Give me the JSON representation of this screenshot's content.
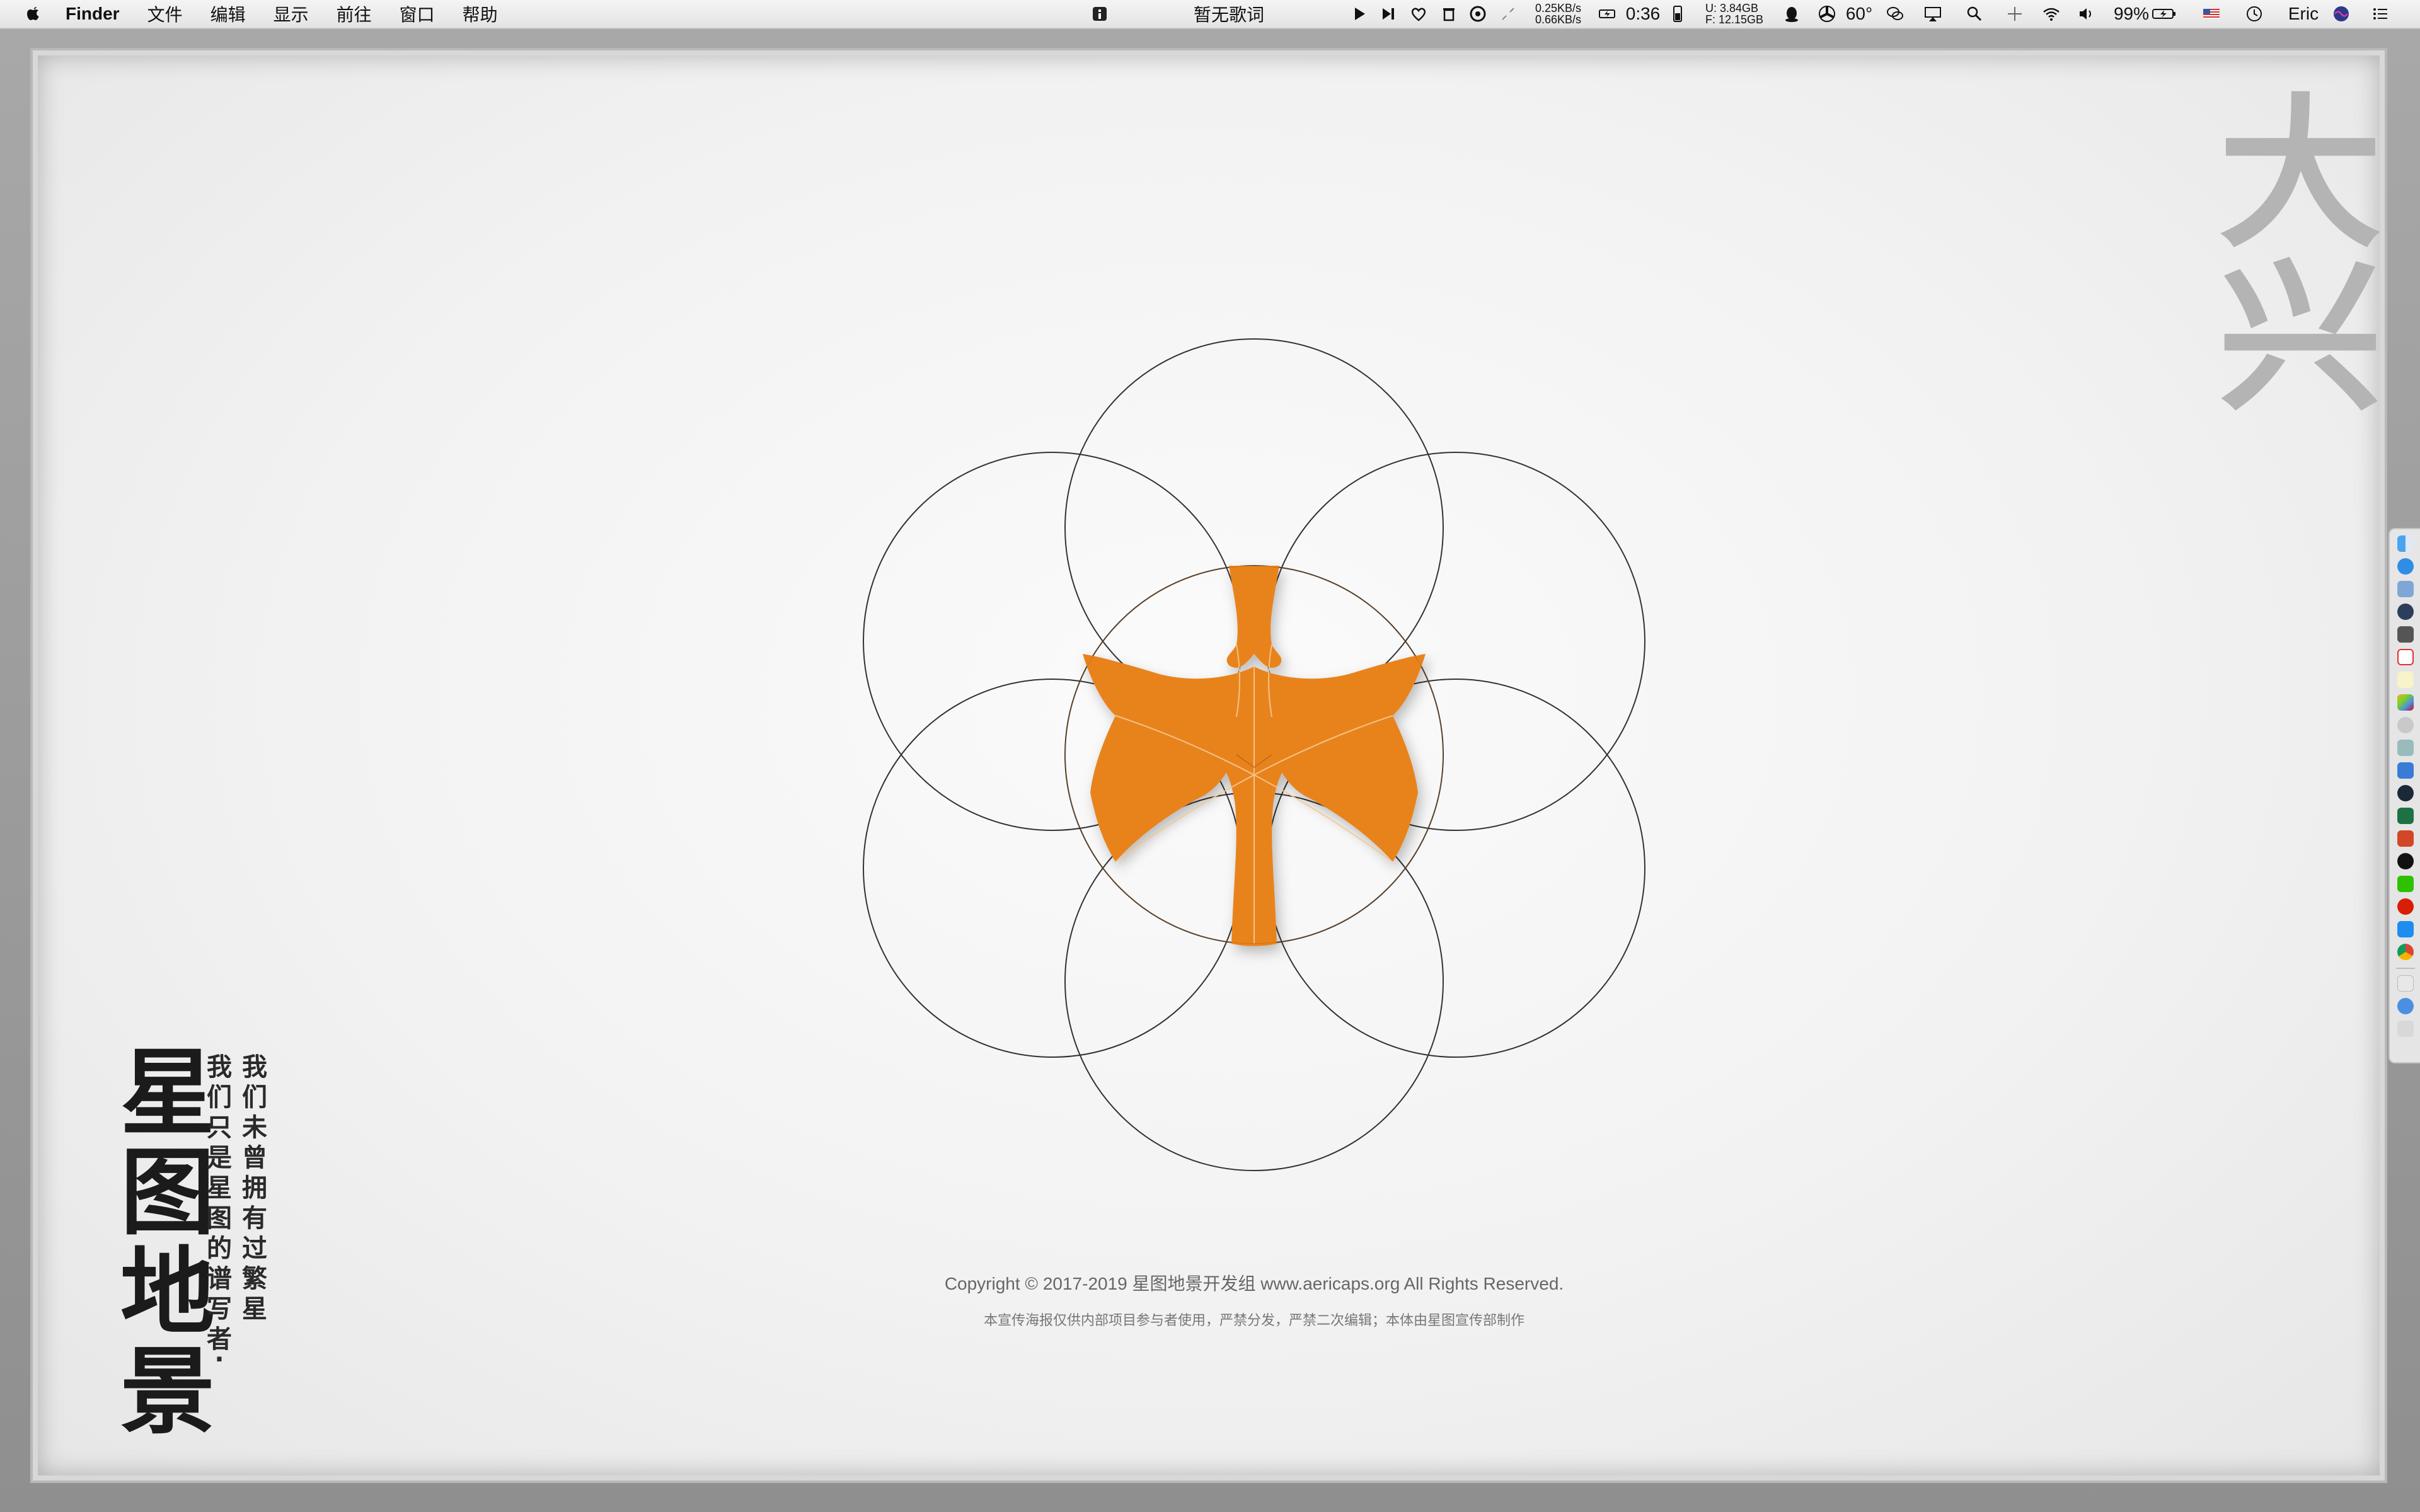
{
  "menubar": {
    "app_name": "Finder",
    "menus": [
      "文件",
      "编辑",
      "显示",
      "前往",
      "窗口",
      "帮助"
    ],
    "lyrics": "暂无歌词",
    "net_up": "0.25KB/s",
    "net_down": "0.66KB/s",
    "battery_time": "0:36",
    "mem_used": "U:  3.84GB",
    "mem_free": "F: 12.15GB",
    "temperature": "60°",
    "battery_percent": "99%",
    "user": "Eric"
  },
  "poster": {
    "title_chars": [
      "星",
      "图",
      "地",
      "景"
    ],
    "subtitle_col_1": [
      "我",
      "们",
      "只",
      "是",
      "星",
      "图",
      "的",
      "谱",
      "写",
      "者",
      "·"
    ],
    "subtitle_col_2": [
      "我",
      "们",
      "未",
      "曾",
      "拥",
      "有",
      "过",
      "繁",
      "星"
    ],
    "corner_chars": [
      "大",
      "兴"
    ],
    "copyright": "Copyright © 2017-2019  星图地景开发组 www.aericaps.org   All Rights Reserved.",
    "notice": "本宣传海报仅供内部项目参与者使用，严禁分发，严禁二次编辑；本体由星图宣传部制作"
  },
  "colors": {
    "accent_orange": "#e8831f",
    "circle_stroke": "#333333"
  },
  "dock": {
    "icons": [
      "finder-icon",
      "safari-icon",
      "preview-icon",
      "quicktime-icon",
      "camera-icon",
      "calendar-icon",
      "notes-icon",
      "photos-icon",
      "settings-icon",
      "printer-icon",
      "mail-icon",
      "steam-icon",
      "excel-icon",
      "powerpoint-icon",
      "qq-icon",
      "wechat-icon",
      "netease-music-icon",
      "app-store-icon",
      "chrome-icon",
      "documents-icon",
      "downloads-icon",
      "trash-icon"
    ]
  }
}
